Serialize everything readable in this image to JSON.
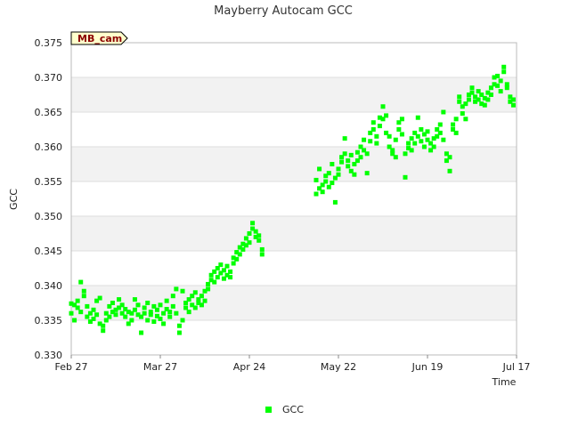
{
  "chart_data": {
    "type": "scatter",
    "title": "Mayberry Autocam GCC",
    "xlabel": "Time",
    "ylabel": "GCC",
    "site_tag": "MB_cam",
    "xlim": [
      "2018-02-27",
      "2018-07-17"
    ],
    "ylim": [
      0.33,
      0.375
    ],
    "x_ticks": [
      {
        "date": "2018-02-27",
        "label": "Feb 27"
      },
      {
        "date": "2018-03-27",
        "label": "Mar 27"
      },
      {
        "date": "2018-04-24",
        "label": "Apr 24"
      },
      {
        "date": "2018-05-22",
        "label": "May 22"
      },
      {
        "date": "2018-06-19",
        "label": "Jun 19"
      },
      {
        "date": "2018-07-17",
        "label": "Jul 17"
      }
    ],
    "y_ticks": [
      {
        "value": 0.33,
        "label": "0.330"
      },
      {
        "value": 0.335,
        "label": "0.335"
      },
      {
        "value": 0.34,
        "label": "0.340"
      },
      {
        "value": 0.345,
        "label": "0.345"
      },
      {
        "value": 0.35,
        "label": "0.350"
      },
      {
        "value": 0.355,
        "label": "0.355"
      },
      {
        "value": 0.36,
        "label": "0.360"
      },
      {
        "value": 0.365,
        "label": "0.365"
      },
      {
        "value": 0.37,
        "label": "0.370"
      },
      {
        "value": 0.375,
        "label": "0.375"
      }
    ],
    "grid": true,
    "legend_position": "bottom-center",
    "colors": {
      "series": "#00ff00",
      "band": "#f2f2f2",
      "grid": "#dddddd",
      "tag_fill": "#ffffcc"
    },
    "series": [
      {
        "name": "GCC",
        "points": [
          [
            "2018-02-27",
            0.3374
          ],
          [
            "2018-02-27",
            0.336
          ],
          [
            "2018-02-28",
            0.3372
          ],
          [
            "2018-02-28",
            0.335
          ],
          [
            "2018-03-01",
            0.3368
          ],
          [
            "2018-03-01",
            0.3378
          ],
          [
            "2018-03-02",
            0.3362
          ],
          [
            "2018-03-02",
            0.3405
          ],
          [
            "2018-03-03",
            0.3385
          ],
          [
            "2018-03-03",
            0.3392
          ],
          [
            "2018-03-04",
            0.3355
          ],
          [
            "2018-03-04",
            0.337
          ],
          [
            "2018-03-05",
            0.336
          ],
          [
            "2018-03-05",
            0.3348
          ],
          [
            "2018-03-06",
            0.3365
          ],
          [
            "2018-03-06",
            0.3352
          ],
          [
            "2018-03-07",
            0.3378
          ],
          [
            "2018-03-07",
            0.3358
          ],
          [
            "2018-03-08",
            0.3345
          ],
          [
            "2018-03-08",
            0.3382
          ],
          [
            "2018-03-09",
            0.3335
          ],
          [
            "2018-03-09",
            0.3342
          ],
          [
            "2018-03-10",
            0.336
          ],
          [
            "2018-03-10",
            0.335
          ],
          [
            "2018-03-11",
            0.337
          ],
          [
            "2018-03-11",
            0.3355
          ],
          [
            "2018-03-12",
            0.3375
          ],
          [
            "2018-03-12",
            0.3362
          ],
          [
            "2018-03-13",
            0.3358
          ],
          [
            "2018-03-13",
            0.3365
          ],
          [
            "2018-03-14",
            0.338
          ],
          [
            "2018-03-14",
            0.3368
          ],
          [
            "2018-03-15",
            0.336
          ],
          [
            "2018-03-15",
            0.3372
          ],
          [
            "2018-03-16",
            0.3355
          ],
          [
            "2018-03-16",
            0.3366
          ],
          [
            "2018-03-17",
            0.3345
          ],
          [
            "2018-03-17",
            0.3362
          ],
          [
            "2018-03-18",
            0.336
          ],
          [
            "2018-03-18",
            0.335
          ],
          [
            "2018-03-19",
            0.338
          ],
          [
            "2018-03-19",
            0.3365
          ],
          [
            "2018-03-20",
            0.3358
          ],
          [
            "2018-03-20",
            0.3372
          ],
          [
            "2018-03-21",
            0.3332
          ],
          [
            "2018-03-21",
            0.3355
          ],
          [
            "2018-03-22",
            0.336
          ],
          [
            "2018-03-22",
            0.3368
          ],
          [
            "2018-03-23",
            0.335
          ],
          [
            "2018-03-23",
            0.3375
          ],
          [
            "2018-03-24",
            0.3362
          ],
          [
            "2018-03-24",
            0.3358
          ],
          [
            "2018-03-25",
            0.3348
          ],
          [
            "2018-03-25",
            0.337
          ],
          [
            "2018-03-26",
            0.3356
          ],
          [
            "2018-03-26",
            0.3365
          ],
          [
            "2018-03-27",
            0.3352
          ],
          [
            "2018-03-27",
            0.3372
          ],
          [
            "2018-03-28",
            0.336
          ],
          [
            "2018-03-28",
            0.3345
          ],
          [
            "2018-03-29",
            0.3366
          ],
          [
            "2018-03-29",
            0.3378
          ],
          [
            "2018-03-30",
            0.3355
          ],
          [
            "2018-03-30",
            0.3362
          ],
          [
            "2018-03-31",
            0.337
          ],
          [
            "2018-03-31",
            0.3385
          ],
          [
            "2018-04-01",
            0.336
          ],
          [
            "2018-04-01",
            0.3395
          ],
          [
            "2018-04-02",
            0.3332
          ],
          [
            "2018-04-02",
            0.3342
          ],
          [
            "2018-04-03",
            0.335
          ],
          [
            "2018-04-03",
            0.3392
          ],
          [
            "2018-04-04",
            0.3375
          ],
          [
            "2018-04-04",
            0.3368
          ],
          [
            "2018-04-05",
            0.338
          ],
          [
            "2018-04-05",
            0.3362
          ],
          [
            "2018-04-06",
            0.3385
          ],
          [
            "2018-04-06",
            0.3372
          ],
          [
            "2018-04-07",
            0.3368
          ],
          [
            "2018-04-07",
            0.339
          ],
          [
            "2018-04-08",
            0.3375
          ],
          [
            "2018-04-08",
            0.338
          ],
          [
            "2018-04-09",
            0.3372
          ],
          [
            "2018-04-09",
            0.3385
          ],
          [
            "2018-04-10",
            0.3392
          ],
          [
            "2018-04-10",
            0.3378
          ],
          [
            "2018-04-11",
            0.3402
          ],
          [
            "2018-04-11",
            0.3395
          ],
          [
            "2018-04-12",
            0.3408
          ],
          [
            "2018-04-12",
            0.3415
          ],
          [
            "2018-04-13",
            0.342
          ],
          [
            "2018-04-13",
            0.3405
          ],
          [
            "2018-04-14",
            0.3412
          ],
          [
            "2018-04-14",
            0.3425
          ],
          [
            "2018-04-15",
            0.3418
          ],
          [
            "2018-04-15",
            0.343
          ],
          [
            "2018-04-16",
            0.341
          ],
          [
            "2018-04-16",
            0.3422
          ],
          [
            "2018-04-17",
            0.3415
          ],
          [
            "2018-04-17",
            0.3428
          ],
          [
            "2018-04-18",
            0.342
          ],
          [
            "2018-04-18",
            0.3412
          ],
          [
            "2018-04-19",
            0.344
          ],
          [
            "2018-04-19",
            0.3432
          ],
          [
            "2018-04-20",
            0.3448
          ],
          [
            "2018-04-20",
            0.3438
          ],
          [
            "2018-04-21",
            0.3455
          ],
          [
            "2018-04-21",
            0.3445
          ],
          [
            "2018-04-22",
            0.346
          ],
          [
            "2018-04-22",
            0.3452
          ],
          [
            "2018-04-23",
            0.3468
          ],
          [
            "2018-04-23",
            0.3458
          ],
          [
            "2018-04-24",
            0.3475
          ],
          [
            "2018-04-24",
            0.3462
          ],
          [
            "2018-04-25",
            0.349
          ],
          [
            "2018-04-25",
            0.3482
          ],
          [
            "2018-04-26",
            0.3478
          ],
          [
            "2018-04-26",
            0.347
          ],
          [
            "2018-04-27",
            0.3465
          ],
          [
            "2018-04-27",
            0.3472
          ],
          [
            "2018-04-28",
            0.3452
          ],
          [
            "2018-04-28",
            0.3445
          ],
          [
            "2018-05-15",
            0.3532
          ],
          [
            "2018-05-15",
            0.3552
          ],
          [
            "2018-05-16",
            0.354
          ],
          [
            "2018-05-16",
            0.3568
          ],
          [
            "2018-05-17",
            0.3545
          ],
          [
            "2018-05-17",
            0.3535
          ],
          [
            "2018-05-18",
            0.355
          ],
          [
            "2018-05-18",
            0.3558
          ],
          [
            "2018-05-19",
            0.3562
          ],
          [
            "2018-05-19",
            0.3542
          ],
          [
            "2018-05-20",
            0.3575
          ],
          [
            "2018-05-20",
            0.3548
          ],
          [
            "2018-05-21",
            0.352
          ],
          [
            "2018-05-21",
            0.3555
          ],
          [
            "2018-05-22",
            0.356
          ],
          [
            "2018-05-22",
            0.3568
          ],
          [
            "2018-05-23",
            0.3585
          ],
          [
            "2018-05-23",
            0.3578
          ],
          [
            "2018-05-24",
            0.3612
          ],
          [
            "2018-05-24",
            0.359
          ],
          [
            "2018-05-25",
            0.358
          ],
          [
            "2018-05-25",
            0.3572
          ],
          [
            "2018-05-26",
            0.3565
          ],
          [
            "2018-05-26",
            0.3588
          ],
          [
            "2018-05-27",
            0.3575
          ],
          [
            "2018-05-27",
            0.356
          ],
          [
            "2018-05-28",
            0.3592
          ],
          [
            "2018-05-28",
            0.358
          ],
          [
            "2018-05-29",
            0.36
          ],
          [
            "2018-05-29",
            0.3585
          ],
          [
            "2018-05-30",
            0.361
          ],
          [
            "2018-05-30",
            0.3595
          ],
          [
            "2018-05-31",
            0.3562
          ],
          [
            "2018-05-31",
            0.359
          ],
          [
            "2018-06-01",
            0.362
          ],
          [
            "2018-06-01",
            0.3608
          ],
          [
            "2018-06-02",
            0.3635
          ],
          [
            "2018-06-02",
            0.3625
          ],
          [
            "2018-06-03",
            0.3615
          ],
          [
            "2018-06-03",
            0.3605
          ],
          [
            "2018-06-04",
            0.363
          ],
          [
            "2018-06-04",
            0.3642
          ],
          [
            "2018-06-05",
            0.3658
          ],
          [
            "2018-06-05",
            0.364
          ],
          [
            "2018-06-06",
            0.3645
          ],
          [
            "2018-06-06",
            0.362
          ],
          [
            "2018-06-07",
            0.3615
          ],
          [
            "2018-06-07",
            0.36
          ],
          [
            "2018-06-08",
            0.359
          ],
          [
            "2018-06-08",
            0.3595
          ],
          [
            "2018-06-09",
            0.3585
          ],
          [
            "2018-06-09",
            0.361
          ],
          [
            "2018-06-10",
            0.3625
          ],
          [
            "2018-06-10",
            0.3635
          ],
          [
            "2018-06-11",
            0.364
          ],
          [
            "2018-06-11",
            0.3618
          ],
          [
            "2018-06-12",
            0.3556
          ],
          [
            "2018-06-12",
            0.359
          ],
          [
            "2018-06-13",
            0.3598
          ],
          [
            "2018-06-13",
            0.3605
          ],
          [
            "2018-06-14",
            0.3612
          ],
          [
            "2018-06-14",
            0.3595
          ],
          [
            "2018-06-15",
            0.362
          ],
          [
            "2018-06-15",
            0.3605
          ],
          [
            "2018-06-16",
            0.3615
          ],
          [
            "2018-06-16",
            0.3642
          ],
          [
            "2018-06-17",
            0.3625
          ],
          [
            "2018-06-17",
            0.3608
          ],
          [
            "2018-06-18",
            0.3618
          ],
          [
            "2018-06-18",
            0.36
          ],
          [
            "2018-06-19",
            0.3622
          ],
          [
            "2018-06-19",
            0.361
          ],
          [
            "2018-06-20",
            0.3605
          ],
          [
            "2018-06-20",
            0.3595
          ],
          [
            "2018-06-21",
            0.3612
          ],
          [
            "2018-06-21",
            0.36
          ],
          [
            "2018-06-22",
            0.3625
          ],
          [
            "2018-06-22",
            0.3615
          ],
          [
            "2018-06-23",
            0.3632
          ],
          [
            "2018-06-23",
            0.362
          ],
          [
            "2018-06-24",
            0.365
          ],
          [
            "2018-06-24",
            0.361
          ],
          [
            "2018-06-25",
            0.359
          ],
          [
            "2018-06-25",
            0.358
          ],
          [
            "2018-06-26",
            0.3585
          ],
          [
            "2018-06-26",
            0.3565
          ],
          [
            "2018-06-27",
            0.3625
          ],
          [
            "2018-06-27",
            0.3632
          ],
          [
            "2018-06-28",
            0.362
          ],
          [
            "2018-06-28",
            0.364
          ],
          [
            "2018-06-29",
            0.3665
          ],
          [
            "2018-06-29",
            0.3672
          ],
          [
            "2018-06-30",
            0.3658
          ],
          [
            "2018-06-30",
            0.3648
          ],
          [
            "2018-07-01",
            0.364
          ],
          [
            "2018-07-01",
            0.3662
          ],
          [
            "2018-07-02",
            0.3675
          ],
          [
            "2018-07-02",
            0.3668
          ],
          [
            "2018-07-03",
            0.3685
          ],
          [
            "2018-07-03",
            0.3678
          ],
          [
            "2018-07-04",
            0.3672
          ],
          [
            "2018-07-04",
            0.3665
          ],
          [
            "2018-07-05",
            0.3668
          ],
          [
            "2018-07-05",
            0.368
          ],
          [
            "2018-07-06",
            0.3662
          ],
          [
            "2018-07-06",
            0.3675
          ],
          [
            "2018-07-07",
            0.367
          ],
          [
            "2018-07-07",
            0.366
          ],
          [
            "2018-07-08",
            0.3678
          ],
          [
            "2018-07-08",
            0.3668
          ],
          [
            "2018-07-09",
            0.3685
          ],
          [
            "2018-07-09",
            0.3675
          ],
          [
            "2018-07-10",
            0.37
          ],
          [
            "2018-07-10",
            0.369
          ],
          [
            "2018-07-11",
            0.3688
          ],
          [
            "2018-07-11",
            0.3702
          ],
          [
            "2018-07-12",
            0.3695
          ],
          [
            "2018-07-12",
            0.368
          ],
          [
            "2018-07-13",
            0.3715
          ],
          [
            "2018-07-13",
            0.3708
          ],
          [
            "2018-07-14",
            0.369
          ],
          [
            "2018-07-14",
            0.3685
          ],
          [
            "2018-07-15",
            0.3672
          ],
          [
            "2018-07-15",
            0.3665
          ],
          [
            "2018-07-16",
            0.3668
          ],
          [
            "2018-07-16",
            0.366
          ]
        ]
      }
    ]
  }
}
